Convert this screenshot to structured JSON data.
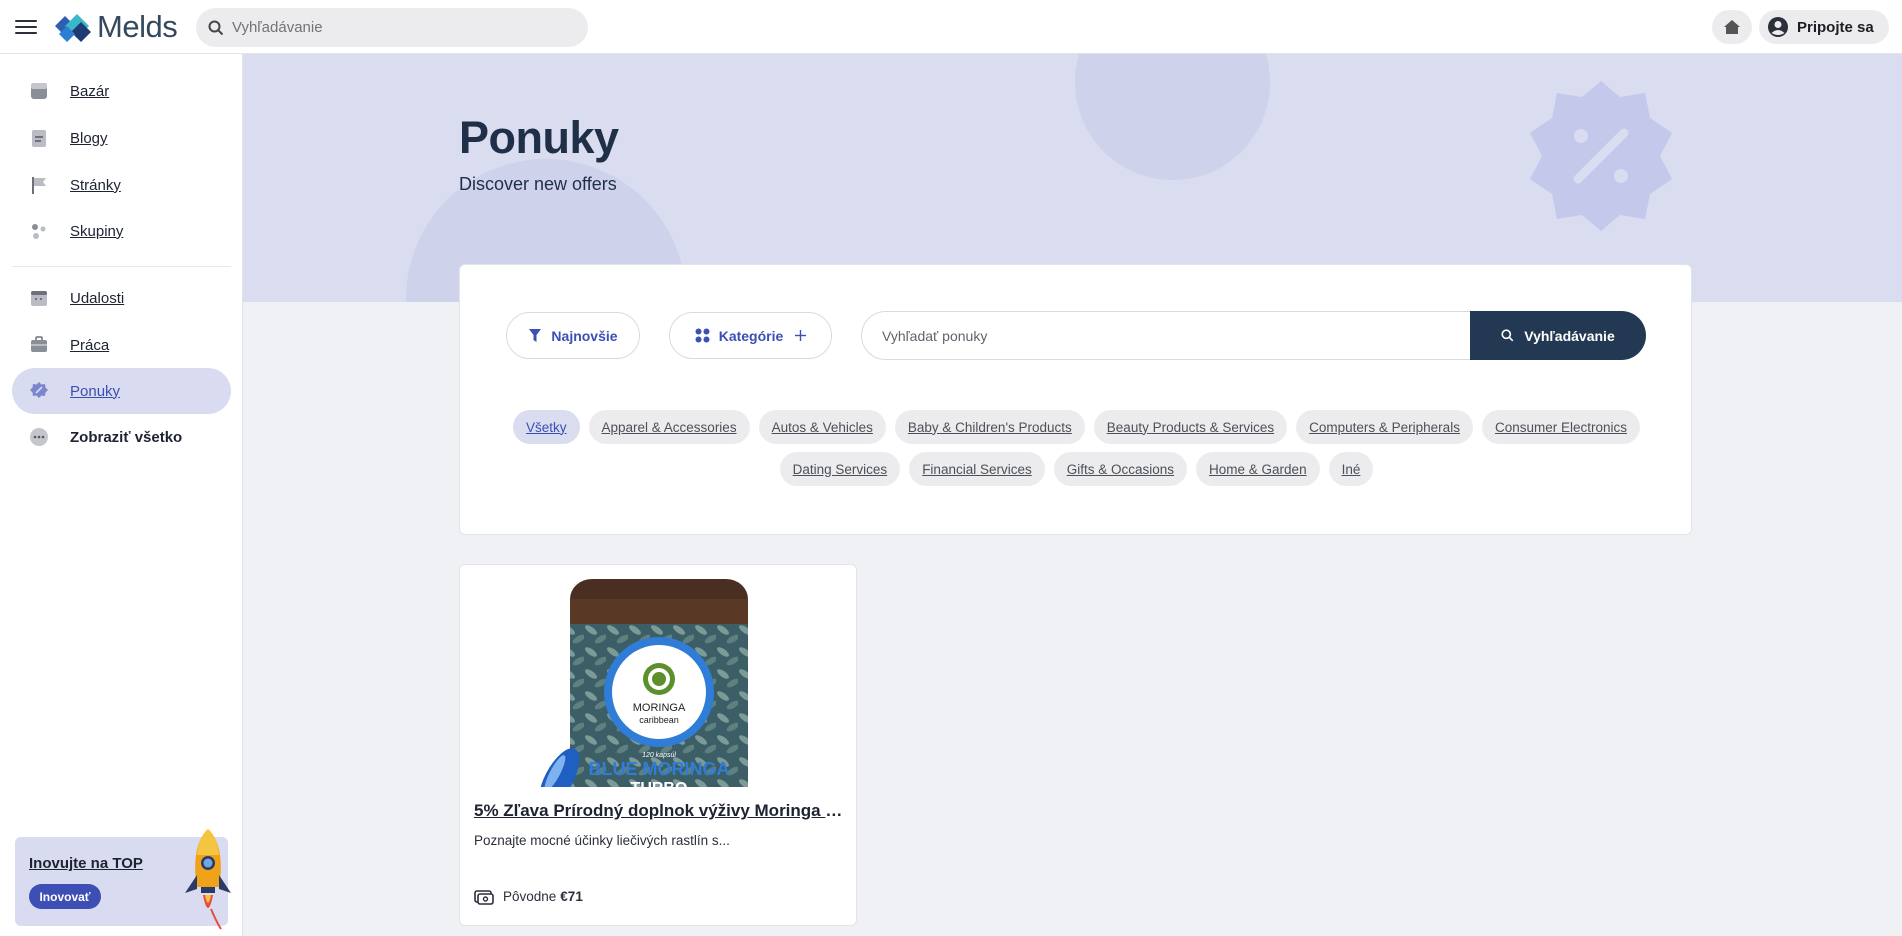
{
  "topbar": {
    "brand": "Melds",
    "search_placeholder": "Vyhľadávanie",
    "join_label": "Pripojte sa"
  },
  "sidebar": {
    "items": [
      {
        "label": "Bazár",
        "icon": "store-icon"
      },
      {
        "label": "Blogy",
        "icon": "blog-icon"
      },
      {
        "label": "Stránky",
        "icon": "flag-icon"
      },
      {
        "label": "Skupiny",
        "icon": "groups-icon"
      },
      {
        "label": "Udalosti",
        "icon": "calendar-icon"
      },
      {
        "label": "Práca",
        "icon": "briefcase-icon"
      },
      {
        "label": "Ponuky",
        "icon": "offer-badge-icon",
        "active": true
      },
      {
        "label": "Zobraziť všetko",
        "icon": "more-icon"
      }
    ],
    "promo": {
      "title": "Inovujte na TOP",
      "button": "Inovovať"
    }
  },
  "hero": {
    "title": "Ponuky",
    "subtitle": "Discover new offers"
  },
  "filters": {
    "sort_label": "Najnovšie",
    "category_label": "Kategórie",
    "search_placeholder": "Vyhľadať ponuky",
    "search_button": "Vyhľadávanie",
    "chips": [
      "Všetky",
      "Apparel & Accessories",
      "Autos & Vehicles",
      "Baby & Children's Products",
      "Beauty Products & Services",
      "Computers & Peripherals",
      "Consumer Electronics",
      "Dating Services",
      "Financial Services",
      "Gifts & Occasions",
      "Home & Garden",
      "Iné"
    ],
    "active_chip": "Všetky"
  },
  "offers": [
    {
      "title": "5% Zľava Prírodný doplnok výživy Moringa Bl...",
      "description": "Poznajte mocné účinky liečivých rastlín s...",
      "price_label": "Pôvodne",
      "price": "€71",
      "image_text": {
        "brand": "MORINGA",
        "sub": "caribbean",
        "capsules": "120 kapsúl",
        "product": "BLUE MORINGA",
        "variant": "TURBO"
      }
    }
  ],
  "colors": {
    "accent": "#3c4fb3",
    "dark_button": "#233953",
    "hero_bg": "#dadcf0",
    "page_bg": "#f0f1f5"
  }
}
